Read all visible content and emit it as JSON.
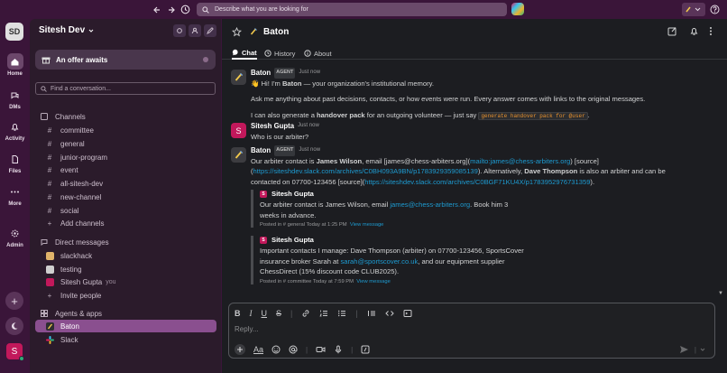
{
  "topbar": {
    "search_placeholder": "Describe what you are looking for"
  },
  "workspace": {
    "initials": "SD",
    "name": "Sitesh Dev",
    "user_initial": "S"
  },
  "rail": {
    "items": [
      {
        "label": "Home",
        "icon": "home-icon"
      },
      {
        "label": "DMs",
        "icon": "dms-icon"
      },
      {
        "label": "Activity",
        "icon": "bell-icon"
      },
      {
        "label": "Files",
        "icon": "files-icon"
      },
      {
        "label": "More",
        "icon": "more-icon"
      },
      {
        "label": "Admin",
        "icon": "gear-icon"
      }
    ]
  },
  "sidebar": {
    "offer": "An offer awaits",
    "find_placeholder": "Find a conversation...",
    "channels_header": "Channels",
    "channels": [
      "committee",
      "general",
      "junior-program",
      "event",
      "all-sitesh-dev",
      "new-channel",
      "social"
    ],
    "add_channels": "Add channels",
    "dms_header": "Direct messages",
    "dms": [
      {
        "name": "slackhack",
        "you": ""
      },
      {
        "name": "testing",
        "you": ""
      },
      {
        "name": "Sitesh Gupta",
        "you": "you"
      }
    ],
    "invite": "Invite people",
    "apps_header": "Agents & apps",
    "apps": [
      "Baton",
      "Slack"
    ]
  },
  "channel": {
    "title": "Baton",
    "tabs": [
      "Chat",
      "History",
      "About"
    ]
  },
  "messages": {
    "m1": {
      "name": "Baton",
      "tag": "AGENT",
      "time": "Just now",
      "l1_pre": "👋 Hi! I'm ",
      "l1_bold": "Baton",
      "l1_post": " — your organization's institutional memory.",
      "l2": "Ask me anything about past decisions, contacts, or how events were run. Every answer comes with links to the original messages.",
      "l3_pre": "I can also generate a ",
      "l3_bold": "handover pack",
      "l3_mid": " for an outgoing volunteer — just say ",
      "l3_code": "generate handover pack for @user",
      "l3_post": "."
    },
    "m2": {
      "name": "Sitesh Gupta",
      "time": "Just now",
      "text": "Who is our arbiter?"
    },
    "m3": {
      "name": "Baton",
      "tag": "AGENT",
      "time": "Just now",
      "t1": "Our arbiter contact is ",
      "b1": "James Wilson",
      "t2": ", email [james@chess-arbiters.org](",
      "link1": "mailto:james@chess-arbiters.org",
      "t3": ") [source]",
      "t4": "(",
      "link2": "https://siteshdev.slack.com/archives/C0BH093A9BN/p1783929359085139",
      "t5": "). Alternatively, ",
      "b2": "Dave Thompson",
      "t6": " is also an arbiter and can be",
      "t7": "contacted on 07700-123456 [source](",
      "link3": "https://siteshdev.slack.com/archives/C0BGF71KU4X/p1783952976731359",
      "t8": ")."
    },
    "q1": {
      "name": "Sitesh Gupta",
      "t1": "Our arbiter contact is James Wilson, email ",
      "link": "james@chess-arbiters.org",
      "t2": ". Book him 3",
      "t3": "weeks in advance.",
      "posted": "Posted in # general   Today at 1:25 PM",
      "view": "View message"
    },
    "q2": {
      "name": "Sitesh Gupta",
      "t1": "Important contacts I manage: Dave Thompson (arbiter) on 07700-123456, SportsCover",
      "t2": "insurance broker Sarah at ",
      "link": "sarah@sportscover.co.uk",
      "t3": ", and our equipment supplier",
      "t4": "ChessDirect (15% discount code CLUB2025).",
      "posted": "Posted in # committee   Today at 7:59 PM",
      "view": "View message"
    }
  },
  "composer": {
    "placeholder": "Reply..."
  },
  "colors": {
    "aubergine": "#3a1539",
    "sidebar": "#2b1b2b",
    "active": "#8a4f8f",
    "link": "#1d9bd1",
    "main_bg": "#1c1d21"
  }
}
